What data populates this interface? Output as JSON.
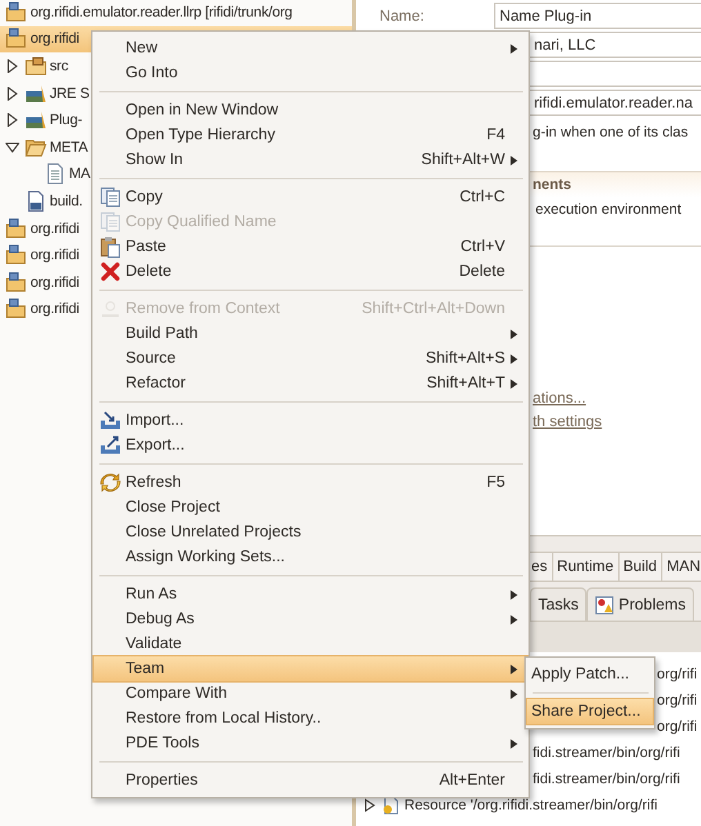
{
  "tree": [
    {
      "kind": "project",
      "label": "org.rifidi.emulator.reader.llrp [rifidi/trunk/org",
      "selected": false
    },
    {
      "kind": "project",
      "label": "org.rifidi",
      "selected": true,
      "children": [
        {
          "kind": "package",
          "label": "src",
          "expanded": false,
          "selected": false
        },
        {
          "kind": "library",
          "label": "JRE S",
          "expanded": false,
          "selected": false
        },
        {
          "kind": "library",
          "label": "Plug-",
          "expanded": false,
          "selected": false
        },
        {
          "kind": "folder",
          "label": "META",
          "expanded": true,
          "selected": false,
          "children": [
            {
              "kind": "file",
              "label": "MA",
              "selected": false
            }
          ]
        },
        {
          "kind": "buildfile",
          "label": "build.",
          "selected": false
        }
      ]
    },
    {
      "kind": "project",
      "label": "org.rifidi",
      "selected": false
    },
    {
      "kind": "project",
      "label": "org.rifidi",
      "selected": false
    },
    {
      "kind": "project",
      "label": "org.rifidi",
      "selected": false
    },
    {
      "kind": "project",
      "label": "org.rifidi",
      "selected": false
    }
  ],
  "editor": {
    "fields": [
      {
        "kind": "text",
        "label": "Name:",
        "value": "Name Plug-in"
      },
      {
        "kind": "text",
        "value": "nari, LLC"
      },
      {
        "kind": "text"
      },
      {
        "kind": "text",
        "value": "rifidi.emulator.reader.na"
      }
    ],
    "note": "g-in when one of its clas",
    "section": {
      "title": "nents",
      "text": "execution environment"
    },
    "links": [
      "ations...",
      "th settings"
    ]
  },
  "bottom": {
    "tabs": [
      {
        "label": "es",
        "selected": false
      },
      {
        "label": "Runtime",
        "selected": false
      },
      {
        "label": "Build",
        "selected": false
      },
      {
        "label": "MAN",
        "selected": false
      }
    ],
    "views": [
      {
        "kind": "plain",
        "label": "Tasks",
        "selected": false
      },
      {
        "kind": "problems",
        "label": "Problems",
        "selected": false
      }
    ],
    "rows": [
      {
        "kind": "entry",
        "label": "org/rifi"
      },
      {
        "kind": "entry",
        "label": "org/rifi"
      },
      {
        "kind": "entry",
        "label": "org/rifi"
      },
      {
        "kind": "entry",
        "label": "fidi.streamer/bin/org/rifi"
      },
      {
        "kind": "entry",
        "label": "fidi.streamer/bin/org/rifi"
      },
      {
        "kind": "resource",
        "label": "Resource '/org.rifidi.streamer/bin/org/rifi"
      }
    ]
  },
  "menu": {
    "groups": [
      {
        "items": [
          {
            "kind": "plain",
            "label": "New",
            "submenu": true,
            "disabled": false,
            "selected": false
          },
          {
            "kind": "plain",
            "label": "Go Into",
            "submenu": false,
            "disabled": false,
            "selected": false
          }
        ]
      },
      {
        "items": [
          {
            "kind": "plain",
            "label": "Open in New Window",
            "submenu": false,
            "disabled": false,
            "selected": false
          },
          {
            "kind": "plain",
            "label": "Open Type Hierarchy",
            "shortcut": "F4",
            "submenu": false,
            "disabled": false,
            "selected": false
          },
          {
            "kind": "plain",
            "label": "Show In",
            "shortcut": "Shift+Alt+W",
            "submenu": true,
            "disabled": false,
            "selected": false
          }
        ]
      },
      {
        "items": [
          {
            "kind": "copy",
            "label": "Copy",
            "shortcut": "Ctrl+C",
            "submenu": false,
            "disabled": false,
            "selected": false
          },
          {
            "kind": "copy",
            "label": "Copy Qualified Name",
            "submenu": false,
            "disabled": true,
            "selected": false
          },
          {
            "kind": "paste",
            "label": "Paste",
            "shortcut": "Ctrl+V",
            "submenu": false,
            "disabled": false,
            "selected": false
          },
          {
            "kind": "delete",
            "label": "Delete",
            "shortcut": "Delete",
            "submenu": false,
            "disabled": false,
            "selected": false
          }
        ]
      },
      {
        "items": [
          {
            "kind": "remove",
            "label": "Remove from Context",
            "shortcut": "Shift+Ctrl+Alt+Down",
            "submenu": false,
            "disabled": true,
            "selected": false
          },
          {
            "kind": "plain",
            "label": "Build Path",
            "submenu": true,
            "disabled": false,
            "selected": false
          },
          {
            "kind": "plain",
            "label": "Source",
            "shortcut": "Shift+Alt+S",
            "submenu": true,
            "disabled": false,
            "selected": false
          },
          {
            "kind": "plain",
            "label": "Refactor",
            "shortcut": "Shift+Alt+T",
            "submenu": true,
            "disabled": false,
            "selected": false
          }
        ]
      },
      {
        "items": [
          {
            "kind": "import",
            "label": "Import...",
            "submenu": false,
            "disabled": false,
            "selected": false
          },
          {
            "kind": "export",
            "label": "Export...",
            "submenu": false,
            "disabled": false,
            "selected": false
          }
        ]
      },
      {
        "items": [
          {
            "kind": "refresh",
            "label": "Refresh",
            "shortcut": "F5",
            "submenu": false,
            "disabled": false,
            "selected": false
          },
          {
            "kind": "plain",
            "label": "Close Project",
            "submenu": false,
            "disabled": false,
            "selected": false
          },
          {
            "kind": "plain",
            "label": "Close Unrelated Projects",
            "submenu": false,
            "disabled": false,
            "selected": false
          },
          {
            "kind": "plain",
            "label": "Assign Working Sets...",
            "submenu": false,
            "disabled": false,
            "selected": false
          }
        ]
      },
      {
        "items": [
          {
            "kind": "plain",
            "label": "Run As",
            "submenu": true,
            "disabled": false,
            "selected": false
          },
          {
            "kind": "plain",
            "label": "Debug As",
            "submenu": true,
            "disabled": false,
            "selected": false
          },
          {
            "kind": "plain",
            "label": "Validate",
            "submenu": false,
            "disabled": false,
            "selected": false
          },
          {
            "kind": "plain",
            "label": "Team",
            "submenu": true,
            "disabled": false,
            "selected": true
          },
          {
            "kind": "plain",
            "label": "Compare With",
            "submenu": true,
            "disabled": false,
            "selected": false
          },
          {
            "kind": "plain",
            "label": "Restore from Local History..",
            "submenu": false,
            "disabled": false,
            "selected": false
          },
          {
            "kind": "plain",
            "label": "PDE Tools",
            "submenu": true,
            "disabled": false,
            "selected": false
          }
        ]
      },
      {
        "items": [
          {
            "kind": "plain",
            "label": "Properties",
            "shortcut": "Alt+Enter",
            "submenu": false,
            "disabled": false,
            "selected": false
          }
        ]
      }
    ]
  },
  "team_menu": {
    "groups": [
      {
        "items": [
          {
            "label": "Apply Patch...",
            "disabled": false,
            "selected": false
          }
        ]
      },
      {
        "items": [
          {
            "label": "Share Project...",
            "disabled": false,
            "selected": true
          }
        ]
      }
    ]
  }
}
